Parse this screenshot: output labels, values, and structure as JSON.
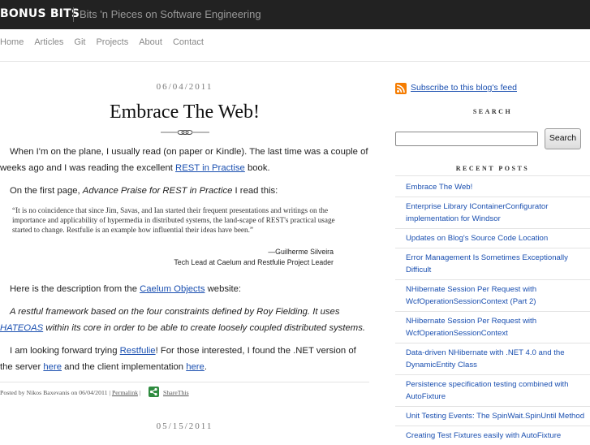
{
  "header": {
    "brand": "BONUS BITS",
    "tagline": "Bits 'n Pieces on Software Engineering"
  },
  "nav": [
    "Home",
    "Articles",
    "Git",
    "Projects",
    "About",
    "Contact"
  ],
  "post": {
    "date": "06/04/2011",
    "title": "Embrace The Web!",
    "p1_a": "When I'm on the plane, I usually read (on paper or Kindle). The last time was a couple of weeks ago and I was reading the excellent ",
    "p1_link": "REST in Practise",
    "p1_b": " book.",
    "p2_a": "On the first page, ",
    "p2_em": "Advance Praise for REST in Practice",
    "p2_b": " I read this:",
    "quote": "“It is no coincidence that since Jim, Savas, and Ian started their frequent presentations and writings on the importance and applicability of hypermedia in distributed systems, the land-scape of REST's practical usage started to change. Restfulie is an example how influential their ideas have been.”",
    "cite_name": "—Guilherme Silveira",
    "cite_role": "Tech Lead at Caelum and Restfulie Project Leader",
    "p3_a": "Here is the description from the ",
    "p3_link": "Caelum Objects",
    "p3_b": " website:",
    "p4_a": "A restful framework based on the four constraints defined by Roy Fielding. It uses ",
    "p4_link": "HATEOAS",
    "p4_b": " within its core in order to be able to create loosely coupled distributed systems.",
    "p5_a": "I am looking forward trying ",
    "p5_link1": "Restfulie",
    "p5_b": "! For those interested, I found the .NET version of the server ",
    "p5_link2": "here",
    "p5_c": " and the client implementation ",
    "p5_link3": "here",
    "p5_d": ".",
    "meta": "Posted by Nikos Baxevanis on 06/04/2011 | ",
    "permalink": "Permalink",
    "meta_sep": " | ",
    "share": "ShareThis",
    "next_date": "05/15/2011"
  },
  "sidebar": {
    "rss": "Subscribe to this blog's feed",
    "search_heading": "SEARCH",
    "search_button": "Search",
    "search_value": "",
    "recent_heading": "RECENT POSTS",
    "recent_posts": [
      "Embrace The Web!",
      "Enterprise Library IContainerConfigurator implementation for Windsor",
      "Updates on Blog's Source Code Location",
      "Error Management Is Sometimes Exceptionally Difficult",
      "NHibernate Session Per Request with WcfOperationSessionContext (Part 2)",
      "NHibernate Session Per Request with WcfOperationSessionContext",
      "Data-driven NHibernate with .NET 4.0 and the DynamicEntity Class",
      "Persistence specification testing combined with AutoFixture",
      "Unit Testing Events: The SpinWait.SpinUntil Method",
      "Creating Test Fixtures easily with AutoFixture"
    ]
  },
  "colors": {
    "topbar": "#222222",
    "link": "#1a4fb0",
    "rss": "#f57c00",
    "share": "#2e8b3f"
  }
}
